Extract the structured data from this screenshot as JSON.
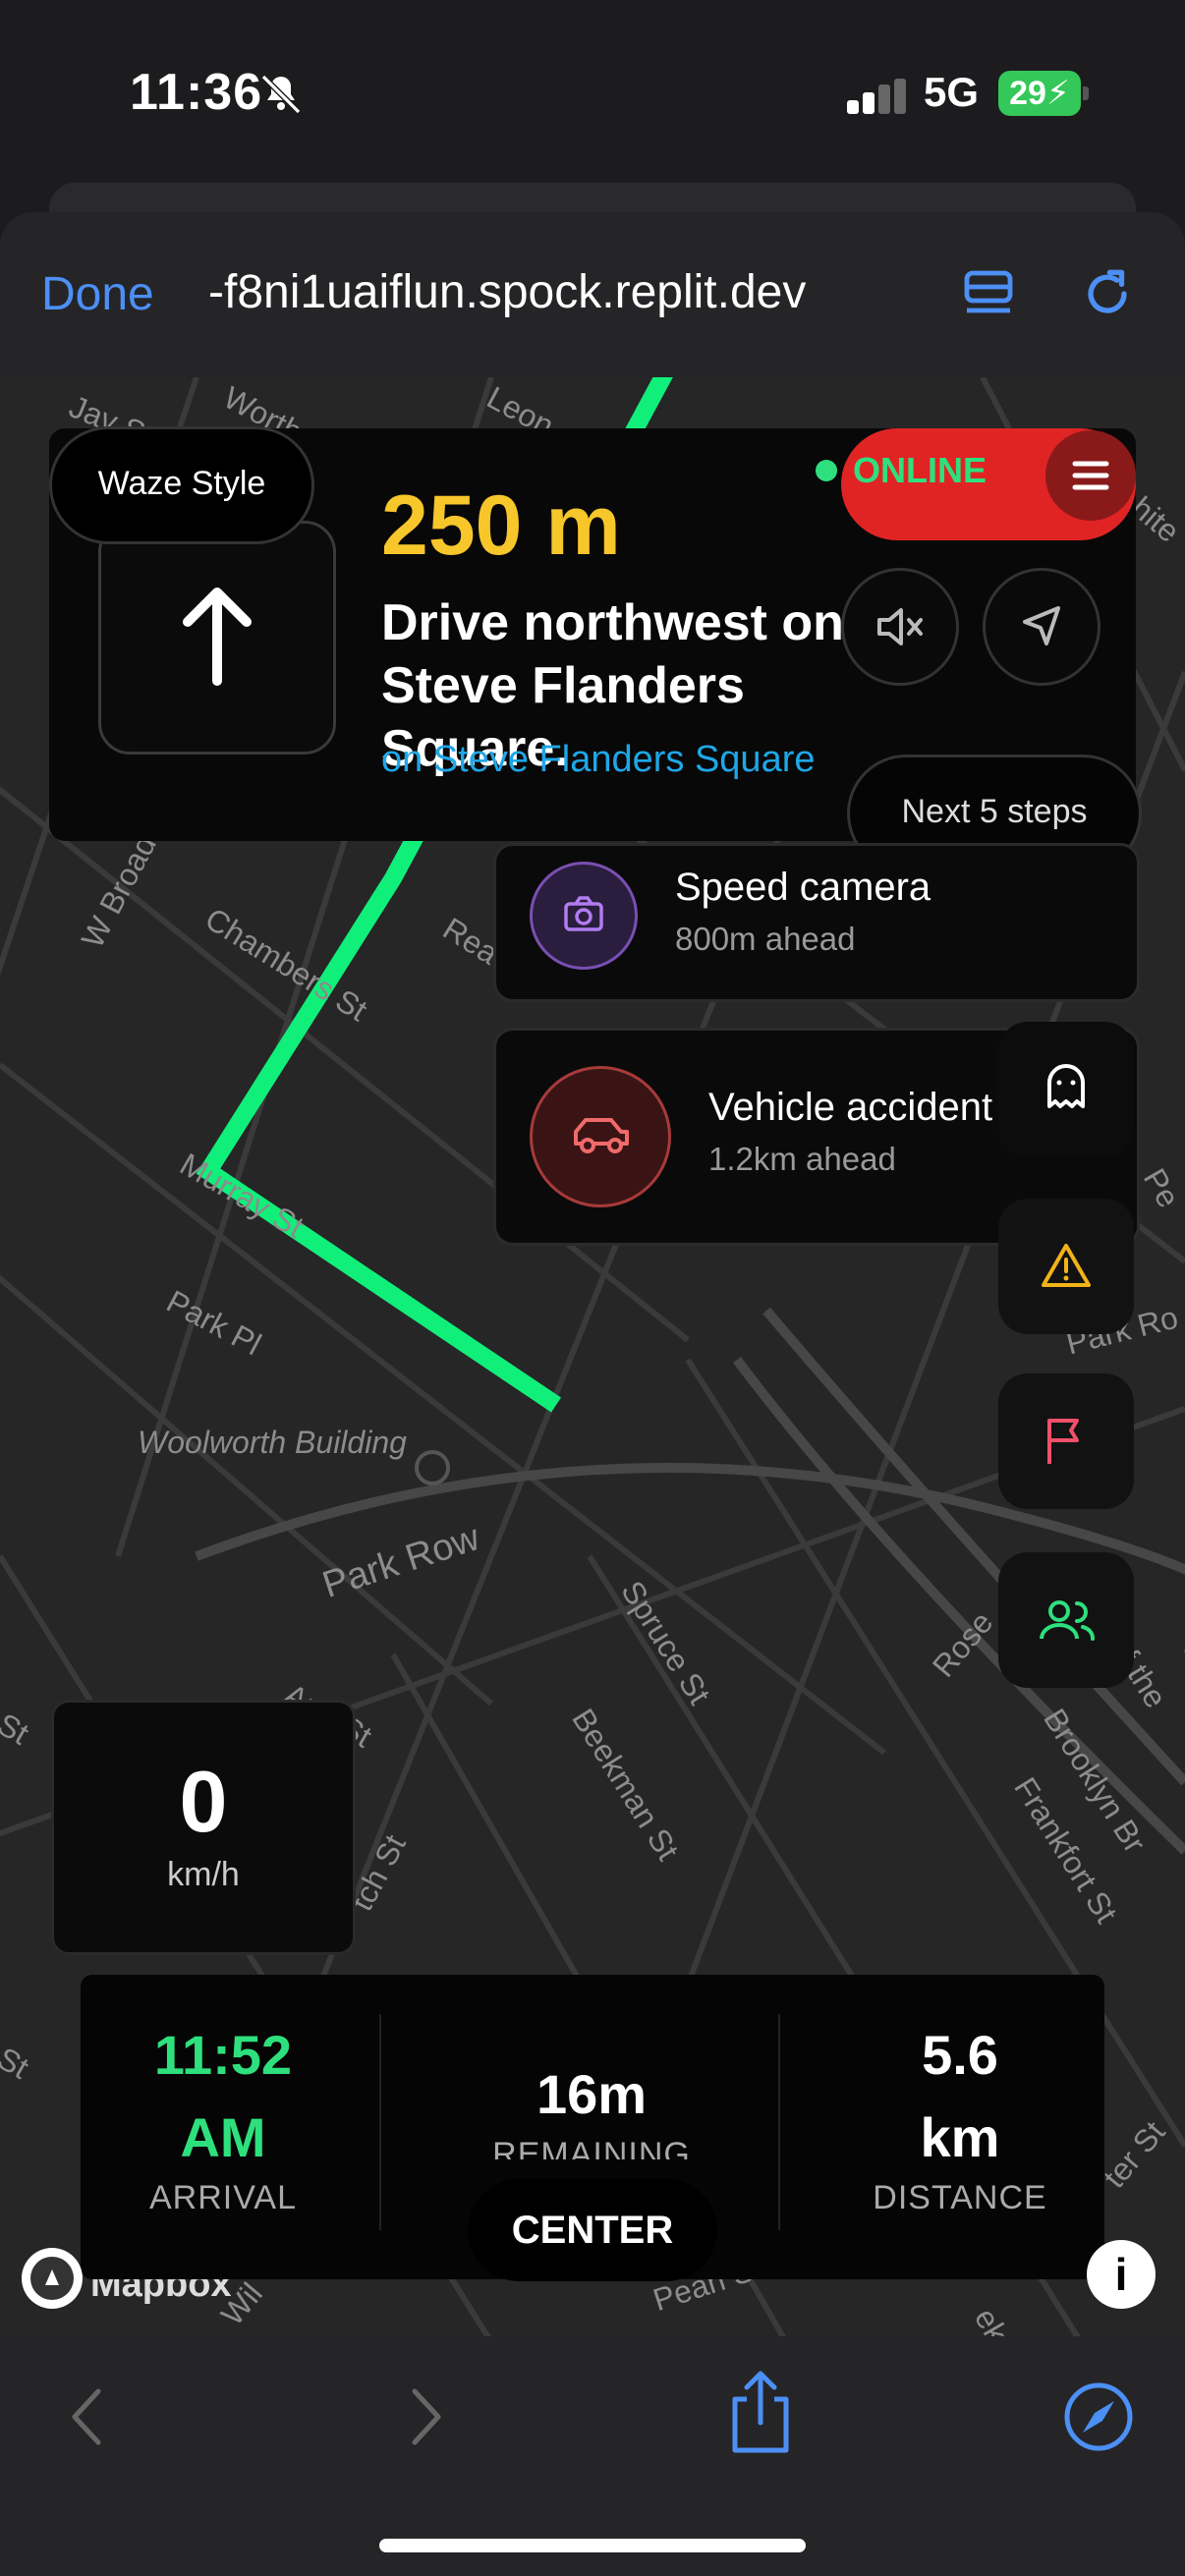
{
  "status_bar": {
    "time": "11:36",
    "network": "5G",
    "battery": "29"
  },
  "browser": {
    "done_label": "Done",
    "url": "-f8ni1uaiflun.spock.replit.dev"
  },
  "map_labels": [
    "Jay St",
    "Worth",
    "Leon",
    "W Broadway",
    "Chambers St",
    "Rea",
    "Murray St",
    "Park Pl",
    "Woolworth Building",
    "Park Row",
    "Spruce St",
    "Beekman St",
    "Ann St",
    "Rose",
    "Brooklyn Br",
    "Frankfort St",
    "Park Ro",
    "hite",
    "Pe",
    "f the",
    "tch St",
    "St",
    "St",
    "ter St",
    "Pearl St",
    "Wil",
    "ekm",
    "Mapbox"
  ],
  "nav": {
    "mode_label": "Waze Style",
    "distance": "250 m",
    "instruction": "Drive northwest on Steve Flanders Square.",
    "street": "on Steve Flanders Square",
    "online_label": "ONLINE",
    "next_steps_label": "Next 5 steps"
  },
  "alerts": [
    {
      "title": "Speed camera",
      "subtitle": "800m ahead"
    },
    {
      "title": "Vehicle accident",
      "subtitle": "1.2km ahead"
    }
  ],
  "speed": {
    "value": "0",
    "unit": "km/h"
  },
  "trip": {
    "arrival_time": "11:52",
    "arrival_ampm": "AM",
    "arrival_label": "ARRIVAL",
    "remaining_value": "16m",
    "remaining_label": "REMAINING",
    "distance_value": "5.6",
    "distance_unit": "km",
    "distance_label": "DISTANCE",
    "center_label": "CENTER"
  },
  "colors": {
    "route": "#11ef7b",
    "accent_blue": "#4c8ff5",
    "distance_yellow": "#f7c62b",
    "online_green": "#2ee07d",
    "danger_red": "#e02424"
  }
}
